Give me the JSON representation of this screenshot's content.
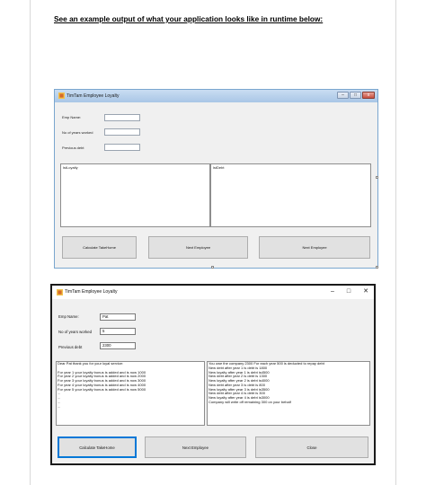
{
  "heading": "See an example output of what your application looks like in runtime below:",
  "window1": {
    "title": "TimTam Employee Loyalty",
    "controls": {
      "minimize": "–",
      "maximize": "□",
      "close": "x"
    },
    "fields": [
      {
        "label": "Emp Name:"
      },
      {
        "label": "No of years  worked"
      },
      {
        "label": "Previous debt"
      }
    ],
    "lists": [
      {
        "text": "lstLoyalty"
      },
      {
        "text": "lstDebt"
      }
    ],
    "buttons": [
      {
        "label": "Calculate TakeHome"
      },
      {
        "label": "Next Employee"
      },
      {
        "label": "Next Employee"
      }
    ]
  },
  "window2": {
    "title": "TimTam Employee Loyalty",
    "controls": {
      "minimize": "–",
      "maximize": "□",
      "close": "✕"
    },
    "fields": [
      {
        "label": "Emp Name:",
        "value": "Pat"
      },
      {
        "label": "No of years  worked",
        "value": "5"
      },
      {
        "label": "Previous debt",
        "value": "2300"
      }
    ],
    "loyalty_lines": [
      "Dear Pat thank you for your loyal service:",
      "",
      "For year 1 your loyalty bonus is added and is now 1000",
      "For year 2 your loyalty bonus is added and is now 2000",
      "For year 3 your loyalty bonus is added and is now 3000",
      "For year 4 your loyalty bonus is added and is now 4000",
      "For year 5 your loyalty bonus is added and is now 5000",
      "...",
      "...",
      "...",
      "..."
    ],
    "debt_lines": [
      "You owe the company 2300 For each year 500 is deducted to repay debt",
      "New debt after year 1 is debt is 1800",
      "New loyalty after year 1 is debt is4500",
      "New debt after year 2 is debt is 1300",
      "New loyalty after year 2 is debt is4000",
      "New debt after year 3 is debt is 800",
      "New loyalty after year 3 is debt is3500",
      "New debt after year 4 is debt is 300",
      "New loyalty after year 4 is debt is3000",
      "Company will write off remaining 300 on your behalf"
    ],
    "buttons": [
      {
        "label": "Calculate TakeHome"
      },
      {
        "label": "Next Employee"
      },
      {
        "label": "Close"
      }
    ]
  }
}
